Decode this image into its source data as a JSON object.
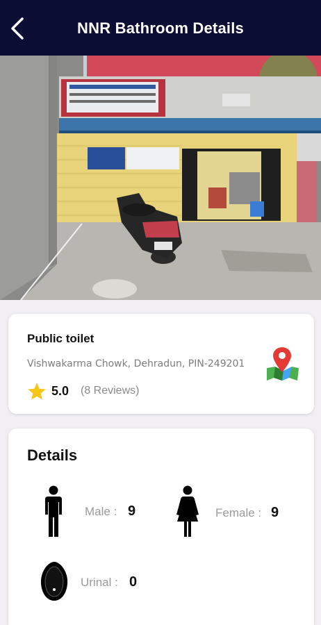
{
  "header": {
    "title": "NNR Bathroom Details",
    "back_icon": "chevron-left-icon"
  },
  "photo": {
    "description_icon": "facility-photo"
  },
  "place": {
    "type": "Public toilet",
    "address": "Vishwakarma Chowk, Dehradun, PIN-249201",
    "rating": "5.0",
    "reviews": "(8 Reviews)",
    "star_color": "#f5c518",
    "map_icon": "map-pin-icon"
  },
  "details": {
    "title": "Details",
    "male_label": "Male :",
    "male_value": "9",
    "female_label": "Female :",
    "female_value": "9",
    "urinal_label": "Urinal :",
    "urinal_value": "0"
  },
  "colors": {
    "header_bg": "#0b0d33",
    "page_bg": "#f1eff3"
  }
}
